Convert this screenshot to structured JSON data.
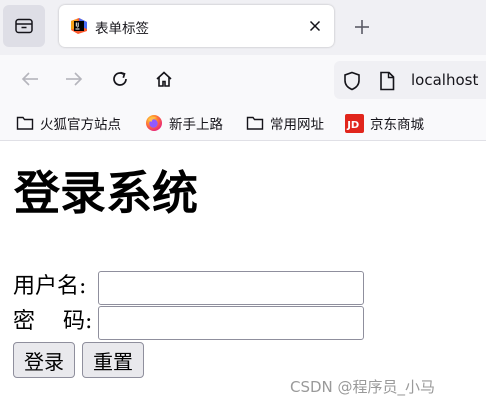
{
  "browser": {
    "tab": {
      "title": "表单标签"
    },
    "address": {
      "url": "localhost"
    },
    "bookmarks": [
      {
        "label": "火狐官方站点",
        "icon": "folder-icon"
      },
      {
        "label": "新手上路",
        "icon": "firefox-icon"
      },
      {
        "label": "常用网址",
        "icon": "folder-icon"
      },
      {
        "label": "京东商城",
        "icon": "jd-icon",
        "icon_text": "JD"
      }
    ],
    "colors": {
      "tabstrip": "#f0f0f4",
      "toolbar": "#f9f9fb",
      "jd_red": "#e1251b",
      "firefox_orange": "#ff7139"
    }
  },
  "page": {
    "title": "登录系统",
    "form": {
      "username_label": "用户名:",
      "username_value": "",
      "password_label": "密    码:",
      "password_value": "",
      "login_button": "登录",
      "reset_button": "重置"
    },
    "watermark": "CSDN @程序员_小马"
  }
}
